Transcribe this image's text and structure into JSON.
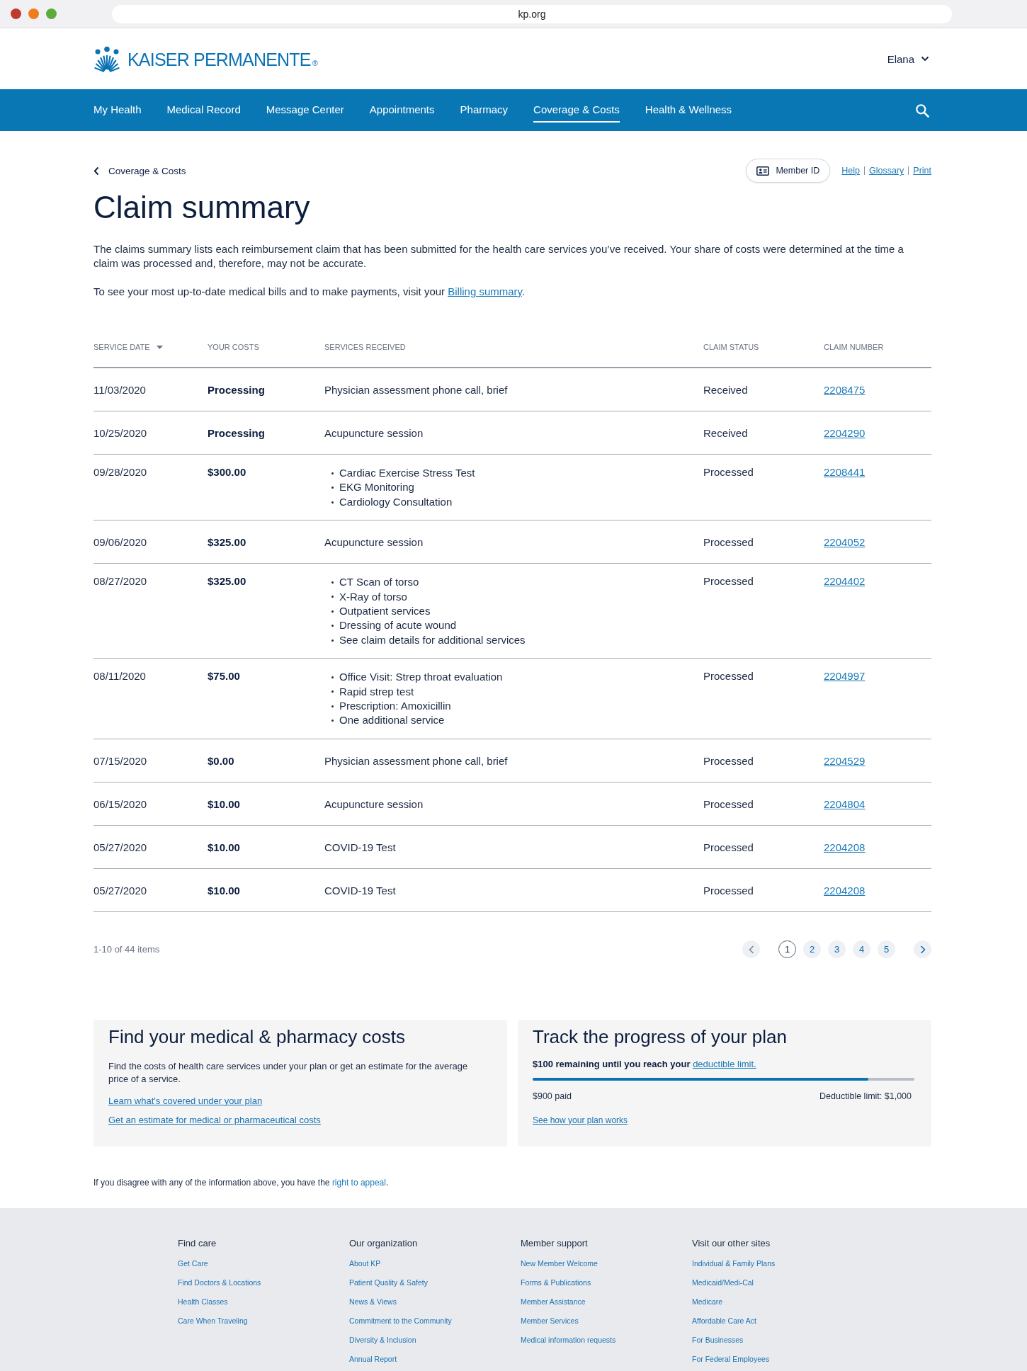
{
  "browser": {
    "url": "kp.org"
  },
  "header": {
    "logo": {
      "wordmark": "KAISER PERMANENTE",
      "mark": "®"
    },
    "user": "Elana"
  },
  "nav": {
    "items": [
      {
        "label": "My Health",
        "selected": false
      },
      {
        "label": "Medical Record",
        "selected": false
      },
      {
        "label": "Message Center",
        "selected": false
      },
      {
        "label": "Appointments",
        "selected": false
      },
      {
        "label": "Pharmacy",
        "selected": false
      },
      {
        "label": "Coverage & Costs",
        "selected": true
      },
      {
        "label": "Health & Wellness",
        "selected": false
      }
    ]
  },
  "breadcrumb": {
    "label": "Coverage & Costs"
  },
  "actions": {
    "member_id": "Member ID",
    "links": [
      "Help",
      "Glossary",
      "Print"
    ]
  },
  "title": "Claim summary",
  "intro": {
    "text": "The claims summary lists each reimbursement claim that has been submitted for the health care services you’ve received. Your share of costs were determined at the time a claim was processed and, therefore, may not be accurate.",
    "billing": {
      "before": "To see your most up-to-date medical bills and to make payments, visit your ",
      "link": "Billing summary",
      "after": "."
    }
  },
  "table": {
    "columns": [
      {
        "label": "SERVICE DATE",
        "sorted": true
      },
      {
        "label": "YOUR COSTS",
        "sorted": false
      },
      {
        "label": "SERVICES RECEIVED",
        "sorted": false
      },
      {
        "label": "CLAIM STATUS",
        "sorted": false
      },
      {
        "label": "CLAIM NUMBER",
        "sorted": false
      }
    ],
    "rows": [
      {
        "service_date": "11/03/2020",
        "your_costs": "Processing",
        "service": "Physician assessment phone call, brief",
        "claim_status": "Received",
        "claim_number": "2208475"
      },
      {
        "service_date": "10/25/2020",
        "your_costs": "Processing",
        "service": "Acupuncture session",
        "claim_status": "Received",
        "claim_number": "2204290"
      },
      {
        "service_date": "09/28/2020",
        "your_costs": "$300.00",
        "services": [
          "Cardiac Exercise Stress Test",
          "EKG Monitoring",
          "Cardiology Consultation"
        ],
        "claim_status": "Processed",
        "claim_number": "2208441"
      },
      {
        "service_date": "09/06/2020",
        "your_costs": "$325.00",
        "service": "Acupuncture session",
        "claim_status": "Processed",
        "claim_number": "2204052"
      },
      {
        "service_date": "08/27/2020",
        "your_costs": "$325.00",
        "services": [
          "CT Scan of torso",
          "X-Ray of torso",
          "Outpatient services",
          "Dressing of acute wound",
          "See claim details for additional services"
        ],
        "claim_status": "Processed",
        "claim_number": "2204402"
      },
      {
        "service_date": "08/11/2020",
        "your_costs": "$75.00",
        "services": [
          "Office Visit: Strep throat evaluation",
          "Rapid strep test",
          "Prescription: Amoxicillin",
          "One additional service"
        ],
        "claim_status": "Processed",
        "claim_number": "2204997"
      },
      {
        "service_date": "07/15/2020",
        "your_costs": "$0.00",
        "service": "Physician assessment phone call, brief",
        "claim_status": "Processed",
        "claim_number": "2204529"
      },
      {
        "service_date": "06/15/2020",
        "your_costs": "$10.00",
        "service": "Acupuncture session",
        "claim_status": "Processed",
        "claim_number": "2204804"
      },
      {
        "service_date": "05/27/2020",
        "your_costs": "$10.00",
        "service": "COVID-19 Test",
        "claim_status": "Processed",
        "claim_number": "2204208"
      },
      {
        "service_date": "05/27/2020",
        "your_costs": "$10.00",
        "service": "COVID-19 Test",
        "claim_status": "Processed",
        "claim_number": "2204208"
      }
    ]
  },
  "pagination": {
    "summary": "1-10 of 44 items",
    "previous": {
      "disabled": true
    },
    "pages": [
      {
        "label": "1",
        "selected": true
      },
      {
        "label": "2",
        "selected": false
      },
      {
        "label": "3",
        "selected": false
      },
      {
        "label": "4",
        "selected": false
      },
      {
        "label": "5",
        "selected": false
      }
    ],
    "next": {
      "disabled": false
    }
  },
  "costs_card": {
    "title": "Find your medical & pharmacy costs",
    "text": "Find the costs of health care services under your plan or get an estimate for the average price of a service.",
    "links": [
      "Learn what's covered under your plan",
      "Get an estimate for medical or pharmaceutical costs"
    ]
  },
  "progress_card": {
    "title": "Track the progress of your plan",
    "remaining": {
      "text": "$100 remaining until you reach your ",
      "link": "deductible limit."
    },
    "level": 0.88,
    "paid": "$900 paid",
    "limit": "Deductible limit: $1,000",
    "link": "See how your plan works"
  },
  "appeal": {
    "text": "If you disagree with any of the information above, you have the ",
    "link": "right to appeal",
    "after": "."
  },
  "footer": {
    "columns": [
      {
        "heading": "Find care",
        "links": [
          "Get Care",
          "Find Doctors & Locations",
          "Health Classes",
          "Care When Traveling"
        ]
      },
      {
        "heading": "Our organization",
        "links": [
          "About KP",
          "Patient Quality & Safety",
          "News & Views",
          "Commitment to the Community",
          "Diversity & Inclusion",
          "Annual Report"
        ]
      },
      {
        "heading": "Member support",
        "links": [
          "New Member Welcome",
          "Forms & Publications",
          "Member Assistance",
          "Member Services",
          "Medical information requests"
        ]
      },
      {
        "heading": "Visit our other sites",
        "links": [
          "Individual & Family Plans",
          "Medicaid/Medi-Cal",
          "Medicare",
          "Affordable Care Act",
          "For Businesses",
          "For Federal Employees"
        ]
      }
    ]
  }
}
